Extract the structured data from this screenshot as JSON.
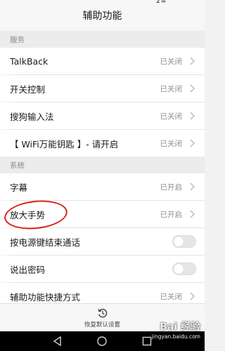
{
  "header": {
    "title": "辅助功能",
    "status_fragment": "2≡"
  },
  "sections": [
    {
      "header": "服务",
      "items": [
        {
          "label": "TalkBack",
          "status": "已关闭"
        },
        {
          "label": "开关控制",
          "status": "已关闭"
        },
        {
          "label": "搜狗输入法",
          "status": "已关闭"
        },
        {
          "label": "【 WiFi万能钥匙 】- 请开启",
          "status": "已关闭"
        }
      ]
    },
    {
      "header": "系统",
      "items": [
        {
          "label": "字幕",
          "status": "已开启"
        },
        {
          "label": "放大手势",
          "status": "已开启"
        },
        {
          "label": "按电源键结束通话",
          "toggle": "off"
        },
        {
          "label": "说出密码",
          "toggle": "off"
        },
        {
          "label": "辅助功能快捷方式",
          "status": "已关闭"
        }
      ]
    }
  ],
  "bottom": {
    "restore_label": "恢复默认设置"
  },
  "watermark": {
    "text": "Bai 经验",
    "url": "jingyan.baidu.com"
  },
  "colors": {
    "annotation_circle": "#d9231d",
    "toggle_off": "#e6e6e6",
    "nav_bar": "#000000"
  }
}
